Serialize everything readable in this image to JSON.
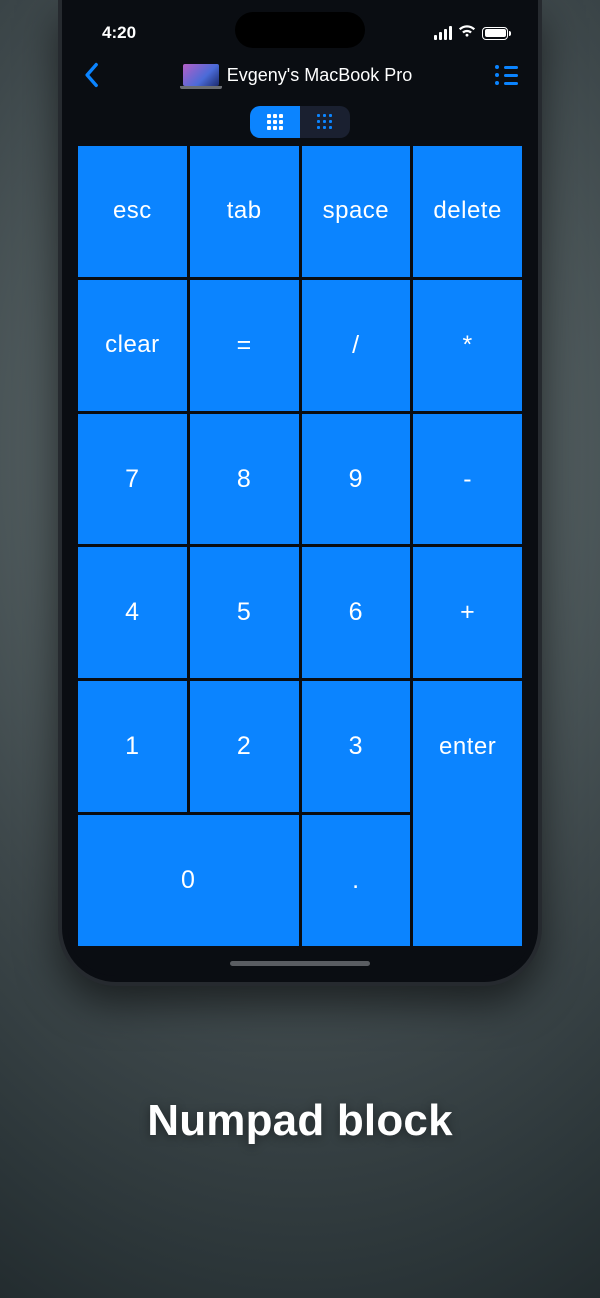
{
  "status": {
    "time": "4:20"
  },
  "nav": {
    "title": "Evgeny's MacBook Pro"
  },
  "keys": {
    "esc": "esc",
    "tab": "tab",
    "space": "space",
    "delete": "delete",
    "clear": "clear",
    "eq": "=",
    "slash": "/",
    "star": "*",
    "n7": "7",
    "n8": "8",
    "n9": "9",
    "minus": "-",
    "n4": "4",
    "n5": "5",
    "n6": "6",
    "plus": "+",
    "n1": "1",
    "n2": "2",
    "n3": "3",
    "n0": "0",
    "dot": ".",
    "enter": "enter"
  },
  "caption": "Numpad block"
}
